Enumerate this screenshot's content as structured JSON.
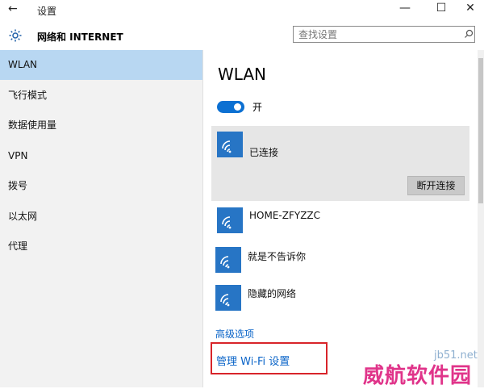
{
  "window": {
    "title": "设置",
    "back_icon": "←",
    "minimize": "—",
    "maximize": "☐",
    "close": "✕"
  },
  "header": {
    "title": "网络和 INTERNET",
    "icon": "gear-icon"
  },
  "search": {
    "placeholder": "查找设置",
    "icon": "search-icon"
  },
  "sidebar": {
    "items": [
      {
        "label": "WLAN",
        "selected": true
      },
      {
        "label": "飞行模式",
        "selected": false
      },
      {
        "label": "数据使用量",
        "selected": false
      },
      {
        "label": "VPN",
        "selected": false
      },
      {
        "label": "拨号",
        "selected": false
      },
      {
        "label": "以太网",
        "selected": false
      },
      {
        "label": "代理",
        "selected": false
      }
    ]
  },
  "main": {
    "title": "WLAN",
    "toggle": {
      "state": "on",
      "label": "开"
    },
    "networks": [
      {
        "name": "已连接",
        "icon": "wifi-icon",
        "connected": true
      },
      {
        "name": "HOME-ZFYZZC",
        "icon": "wifi-icon"
      },
      {
        "name": "就是不告诉你",
        "icon": "wifi-icon"
      },
      {
        "name": "隐藏的网络",
        "icon": "wifi-icon"
      }
    ],
    "disconnect_label": "断开连接",
    "advanced_link": "高级选项",
    "manage_link": "管理 Wi-Fi 设置"
  },
  "watermark": {
    "site": "jb51.net",
    "text": "威航软件园"
  },
  "colors": {
    "accent": "#0c70d2",
    "selected_bg": "#b8d7f2",
    "tile": "#2775c5",
    "link": "#0a64c8",
    "highlight": "#d8242a"
  }
}
